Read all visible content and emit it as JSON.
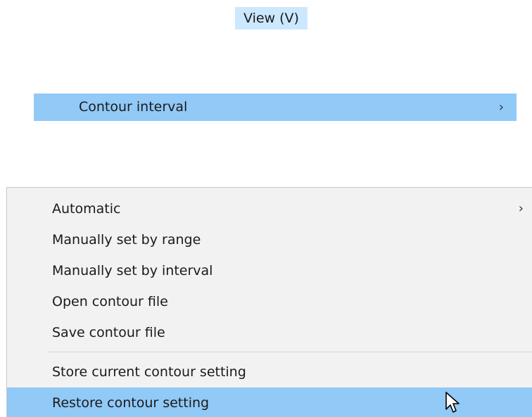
{
  "menu_bar": {
    "view_label": "View (V)"
  },
  "parent_item": {
    "label": "Contour interval",
    "chevron": "›",
    "icon": "chevron-right-icon"
  },
  "dropdown": {
    "items": [
      {
        "label": "Automatic",
        "has_submenu": true,
        "chevron": "›"
      },
      {
        "label": "Manually set by range"
      },
      {
        "label": "Manually set by interval"
      },
      {
        "label": "Open contour file"
      },
      {
        "label": "Save contour file"
      },
      {
        "label": "Store current contour setting"
      },
      {
        "label": "Restore contour setting",
        "highlighted": true
      }
    ]
  },
  "colors": {
    "highlight": "#91c9f7",
    "menu_bar_highlight": "#cce8ff",
    "menu_background": "#f2f2f2"
  },
  "cursor": {
    "icon": "mouse-pointer-icon"
  }
}
